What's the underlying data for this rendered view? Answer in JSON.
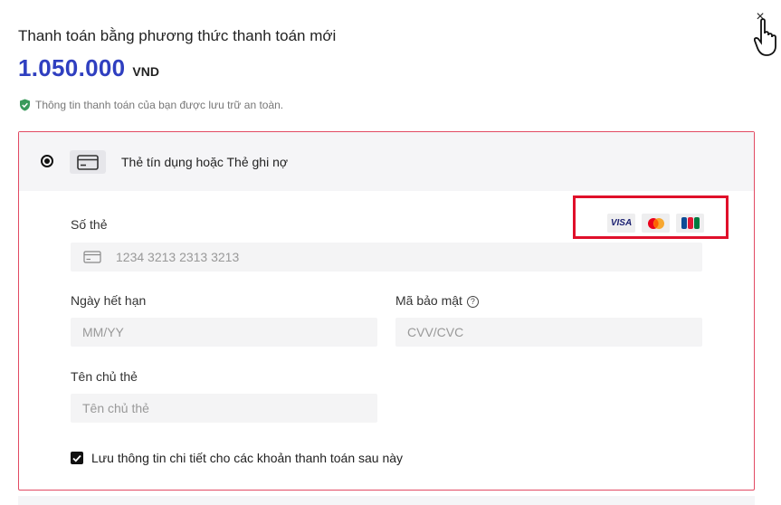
{
  "header": {
    "title": "Thanh toán bằng phương thức thanh toán mới",
    "amount": "1.050.000",
    "currency": "VND",
    "secure_note": "Thông tin thanh toán của bạn được lưu trữ an toàn.",
    "close_glyph": "×"
  },
  "payment_method": {
    "label": "Thẻ tín dụng hoặc Thẻ ghi nợ",
    "brands": [
      "visa-logo",
      "mastercard-logo",
      "jcb-logo"
    ],
    "visa_text": "VISA"
  },
  "form": {
    "card_number_label": "Số thẻ",
    "card_number_placeholder": "1234 3213 2313 3213",
    "expiry_label": "Ngày hết hạn",
    "expiry_placeholder": "MM/YY",
    "cvv_label": "Mã bảo mật",
    "cvv_placeholder": "CVV/CVC",
    "holder_label": "Tên chủ thẻ",
    "holder_placeholder": "Tên chủ thẻ",
    "save_label": "Lưu thông tin chi tiết cho các khoản thanh toán sau này",
    "save_checked": true
  },
  "colors": {
    "amount": "#2f3fc0",
    "panel_border": "#e24a63",
    "highlight": "#e0102a",
    "secure_icon": "#3a9a5b"
  }
}
